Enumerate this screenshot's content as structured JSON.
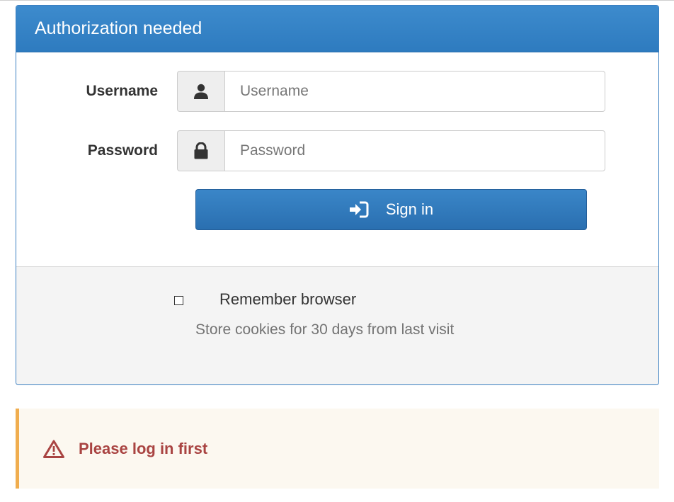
{
  "panel": {
    "title": "Authorization needed"
  },
  "form": {
    "username_label": "Username",
    "username_placeholder": "Username",
    "username_value": "",
    "username_icon": "user-icon",
    "password_label": "Password",
    "password_placeholder": "Password",
    "password_value": "",
    "password_icon": "lock-icon",
    "signin_label": "Sign in",
    "signin_icon": "sign-in-icon"
  },
  "footer": {
    "remember_checked": false,
    "remember_label": "Remember browser",
    "remember_help": "Store cookies for 30 days from last visit"
  },
  "alert": {
    "icon": "warning-triangle-icon",
    "message": "Please log in first"
  },
  "colors": {
    "primary": "#337ab7",
    "alert_text": "#a94442",
    "alert_border": "#f0ad4e",
    "alert_bg": "#fcf8f0"
  }
}
